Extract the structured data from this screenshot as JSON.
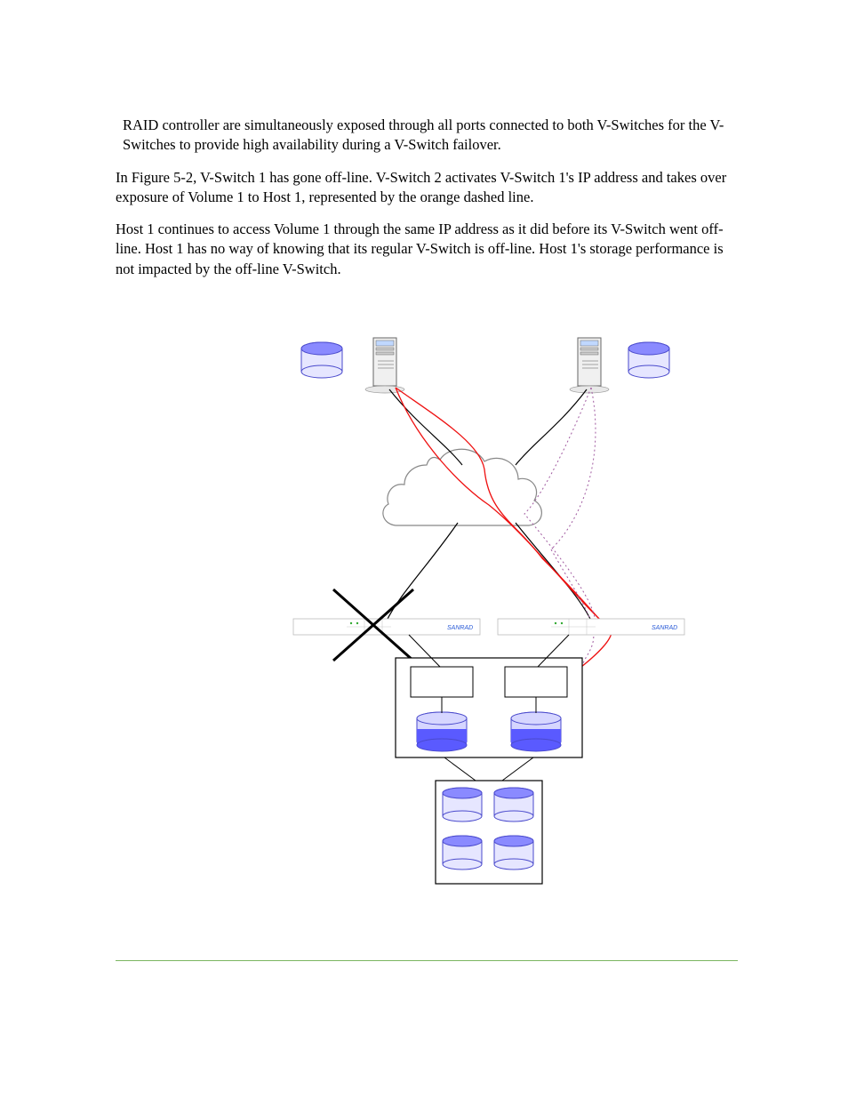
{
  "paragraphs": {
    "p1": "RAID controller are simultaneously exposed through all ports connected to both V-Switches for the V-Switches to provide high availability during a V-Switch failover.",
    "p2": "In Figure 5-2, V-Switch 1 has gone off-line.  V-Switch 2 activates V-Switch 1's IP address and takes over exposure of Volume 1 to Host 1, represented by the orange dashed line.",
    "p3": "Host 1 continues to access Volume 1 through the same IP address as it did before its V-Switch went off-line.  Host 1 has no way of knowing that its regular V-Switch is off-line.  Host 1's storage performance is not impacted by the off-line V-Switch."
  },
  "diagram": {
    "switch_brand": "SANRAD"
  }
}
